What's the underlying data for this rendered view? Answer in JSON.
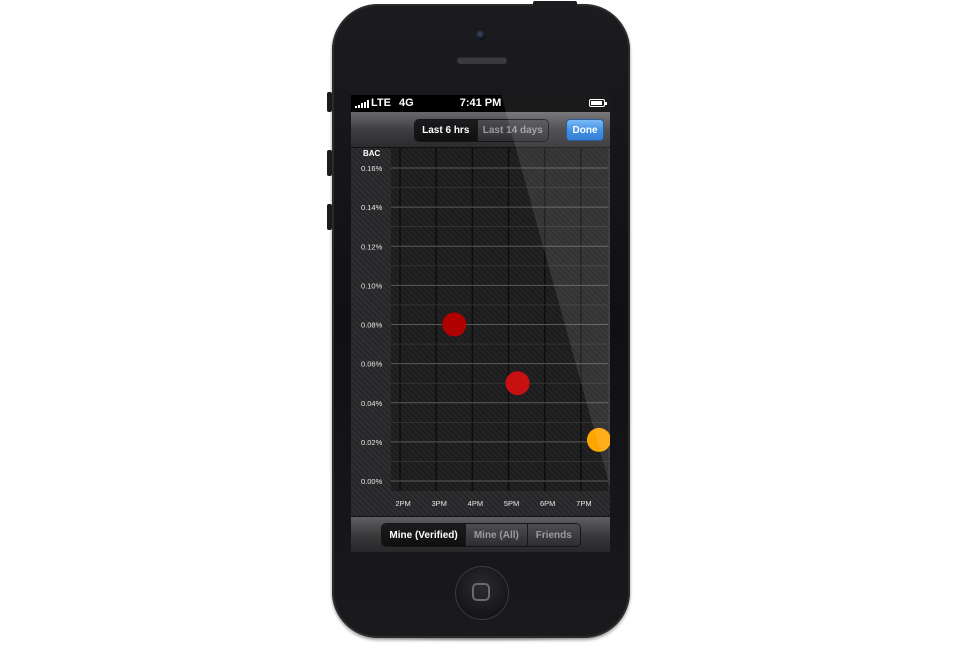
{
  "status_bar": {
    "carrier": "LTE",
    "network": "4G",
    "time": "7:41 PM",
    "signal_bars": 5,
    "battery_level": 0.9
  },
  "nav": {
    "range_options": [
      {
        "label": "Last 6 hrs",
        "selected": true
      },
      {
        "label": "Last 14 days",
        "selected": false
      }
    ],
    "done_label": "Done",
    "done_color": "#2c83e1"
  },
  "filter": {
    "options": [
      {
        "label": "Mine (Verified)",
        "selected": true
      },
      {
        "label": "Mine (All)",
        "selected": false
      },
      {
        "label": "Friends",
        "selected": false
      }
    ]
  },
  "icons": {
    "home": "home-button-icon",
    "battery": "battery-icon",
    "signal": "signal-bars-icon"
  },
  "chart_data": {
    "type": "scatter",
    "ylabel": "BAC",
    "y_tick_labels": [
      "0.16%",
      "0.14%",
      "0.12%",
      "0.10%",
      "0.08%",
      "0.06%",
      "0.04%",
      "0.02%",
      "0.00%"
    ],
    "y_ticks": [
      0.16,
      0.14,
      0.12,
      0.1,
      0.08,
      0.06,
      0.04,
      0.02,
      0.0
    ],
    "x_tick_labels": [
      "2PM",
      "3PM",
      "4PM",
      "5PM",
      "6PM",
      "7PM"
    ],
    "x_ticks": [
      14,
      15,
      16,
      17,
      18,
      19
    ],
    "xlim": [
      13.75,
      19.75
    ],
    "ylim": [
      0,
      0.16
    ],
    "grid": true,
    "points": [
      {
        "x": 15.5,
        "y": 0.08,
        "color": "#b00000"
      },
      {
        "x": 17.25,
        "y": 0.05,
        "color": "#c81010"
      },
      {
        "x": 19.5,
        "y": 0.021,
        "color": "#ffa500"
      }
    ]
  }
}
